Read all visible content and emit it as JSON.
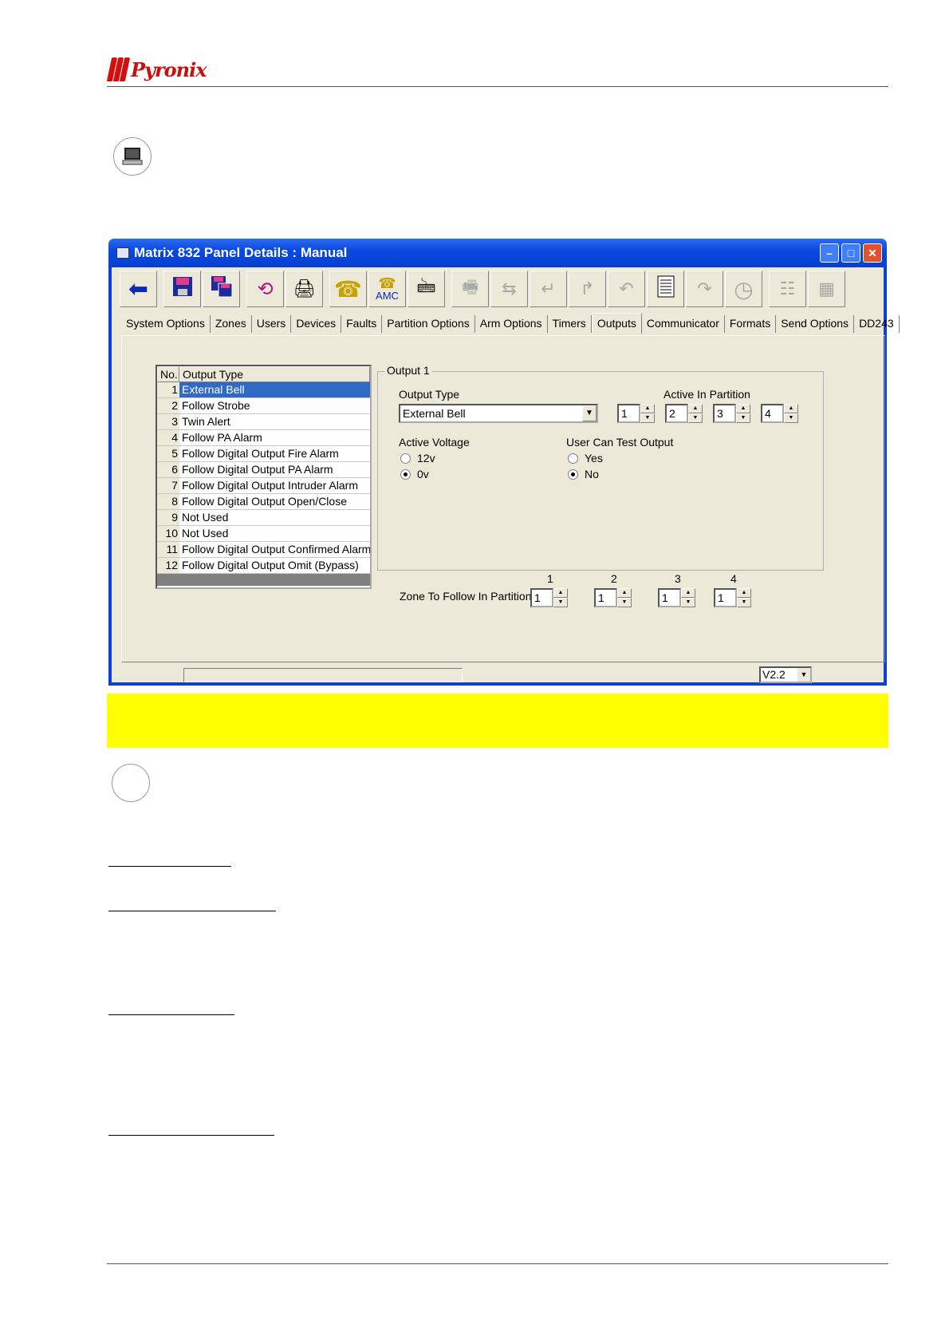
{
  "header": {
    "brand": "Pyronix"
  },
  "window": {
    "title": "Matrix 832 Panel Details : Manual",
    "tabs": [
      "System Options",
      "Zones",
      "Users",
      "Devices",
      "Faults",
      "Partition Options",
      "Arm Options",
      "Timers",
      "Outputs",
      "Communicator",
      "Formats",
      "Send Options",
      "DD243"
    ],
    "active_tab": "Outputs",
    "toolbar": {
      "amc_label": "AMC",
      "icons": [
        "back-arrow-icon",
        "save-icon",
        "save-as-icon",
        "undo-icon",
        "print-icon",
        "phone-icon",
        "amc-icon",
        "upload-download-icon",
        "fax-icon",
        "modem-icon",
        "download-icon",
        "upload-icon",
        "transfer-icon",
        "document-icon",
        "send-icon",
        "clock-icon",
        "keypad-icon",
        "logo-icon"
      ]
    },
    "list": {
      "headers": {
        "no": "No.",
        "type": "Output Type"
      },
      "rows": [
        {
          "no": "1",
          "type": "External Bell"
        },
        {
          "no": "2",
          "type": "Follow Strobe"
        },
        {
          "no": "3",
          "type": "Twin Alert"
        },
        {
          "no": "4",
          "type": "Follow PA Alarm"
        },
        {
          "no": "5",
          "type": "Follow Digital Output Fire Alarm"
        },
        {
          "no": "6",
          "type": "Follow Digital Output PA Alarm"
        },
        {
          "no": "7",
          "type": "Follow Digital Output Intruder Alarm"
        },
        {
          "no": "8",
          "type": "Follow Digital Output Open/Close"
        },
        {
          "no": "9",
          "type": "Not Used"
        },
        {
          "no": "10",
          "type": "Not Used"
        },
        {
          "no": "11",
          "type": "Follow Digital Output Confirmed Alarm"
        },
        {
          "no": "12",
          "type": "Follow Digital Output Omit (Bypass)"
        }
      ]
    },
    "output": {
      "group_title": "Output 1",
      "output_type_label": "Output Type",
      "output_type_value": "External Bell",
      "active_in_partition_label": "Active In Partition",
      "partition_values": [
        "1",
        "2",
        "3",
        "4"
      ],
      "active_voltage_label": "Active Voltage",
      "voltage_options": [
        "12v",
        "0v"
      ],
      "voltage_selected": "0v",
      "user_test_label": "User Can Test Output",
      "user_test_options": [
        "Yes",
        "No"
      ],
      "user_test_selected": "No"
    },
    "zone_follow": {
      "label": "Zone To Follow In Partition",
      "headers": [
        "1",
        "2",
        "3",
        "4"
      ],
      "values": [
        "1",
        "1",
        "1",
        "1"
      ]
    },
    "status": {
      "version": "V2.2"
    }
  }
}
